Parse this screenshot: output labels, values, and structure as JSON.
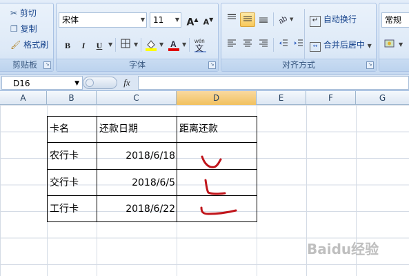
{
  "clipboard": {
    "cut": "剪切",
    "copy": "复制",
    "format_painter": "格式刷",
    "group_label": "剪贴板"
  },
  "font": {
    "name": "宋体",
    "size": "11",
    "grow": "A",
    "shrink": "A",
    "bold": "B",
    "italic": "I",
    "underline": "U",
    "group_label": "字体"
  },
  "alignment": {
    "wrap_text": "自动换行",
    "merge_center": "合并后居中",
    "group_label": "对齐方式"
  },
  "number": {
    "format": "常规"
  },
  "name_box": "D16",
  "fx_label": "fx",
  "formula_value": "",
  "columns": [
    "A",
    "B",
    "C",
    "D",
    "E",
    "F",
    "G"
  ],
  "selected_column": "D",
  "table": {
    "headers": [
      "卡名",
      "还款日期",
      "距离还款"
    ],
    "rows": [
      {
        "card": "农行卡",
        "date": "2018/6/18"
      },
      {
        "card": "交行卡",
        "date": "2018/6/5"
      },
      {
        "card": "工行卡",
        "date": "2018/6/22"
      }
    ]
  },
  "colors": {
    "ink": "#c0151b",
    "selection": "#f1c15f",
    "ribbon": "#d6e4f5"
  },
  "watermark": "Baidu经验"
}
